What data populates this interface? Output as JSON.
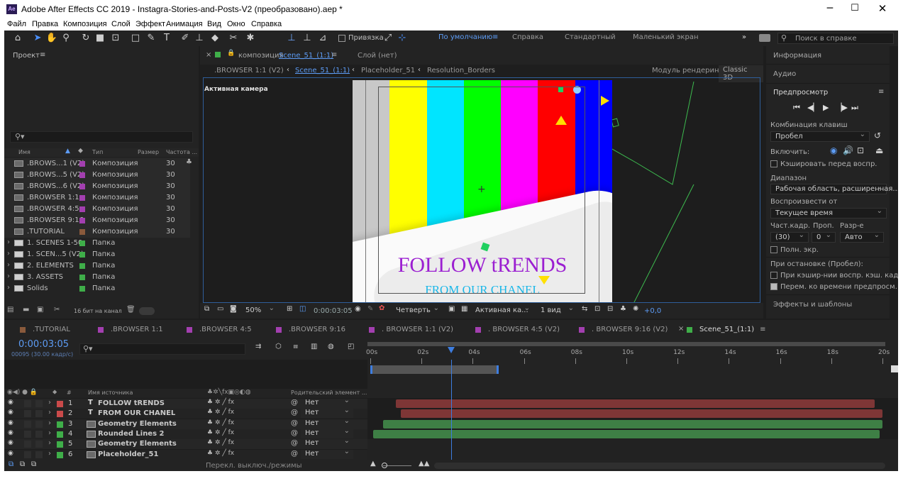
{
  "window": {
    "title": "Adobe After Effects CC 2019 - Instagra-Stories-and-Posts-V2 (преобразовано).aep *",
    "logo": "Ae"
  },
  "menu": [
    "Файл",
    "Правка",
    "Композиция",
    "Слой",
    "Эффект",
    "Анимация",
    "Вид",
    "Окно",
    "Справка"
  ],
  "toolbar": {
    "snap_label": "Привязка",
    "workspaces": [
      "По умолчанию",
      "Справка",
      "Стандартный",
      "Маленький экран"
    ],
    "search_placeholder": "Поиск в справке"
  },
  "project": {
    "title": "Проект",
    "columns": [
      "Имя",
      "Тип",
      "Размер",
      "Частота ..."
    ],
    "items": [
      {
        "name": ".BROWS...1 (V2)",
        "type": "Композиция",
        "fps": "30",
        "color": "#a33fb0",
        "kind": "comp"
      },
      {
        "name": ".BROWS...5 (V2)",
        "type": "Композиция",
        "fps": "30",
        "color": "#a33fb0",
        "kind": "comp"
      },
      {
        "name": ".BROWS...6 (V2)",
        "type": "Композиция",
        "fps": "30",
        "color": "#a33fb0",
        "kind": "comp"
      },
      {
        "name": ".BROWSER 1:1",
        "type": "Композиция",
        "fps": "30",
        "color": "#a33fb0",
        "kind": "comp"
      },
      {
        "name": ".BROWSER 4:5",
        "type": "Композиция",
        "fps": "30",
        "color": "#a33fb0",
        "kind": "comp"
      },
      {
        "name": ".BROWSER 9:16",
        "type": "Композиция",
        "fps": "30",
        "color": "#a33fb0",
        "kind": "comp"
      },
      {
        "name": ".TUTORIAL",
        "type": "Композиция",
        "fps": "30",
        "color": "#8a5a3c",
        "kind": "comp"
      },
      {
        "name": "1. SCENES 1-50",
        "type": "Папка",
        "fps": "",
        "color": "#3fae49",
        "kind": "folder"
      },
      {
        "name": "1. SCEN...5 (V2)",
        "type": "Папка",
        "fps": "",
        "color": "#3fae49",
        "kind": "folder"
      },
      {
        "name": "2. ELEMENTS",
        "type": "Папка",
        "fps": "",
        "color": "#3fae49",
        "kind": "folder"
      },
      {
        "name": "3. ASSETS",
        "type": "Папка",
        "fps": "",
        "color": "#3fae49",
        "kind": "folder"
      },
      {
        "name": "Solids",
        "type": "Папка",
        "fps": "",
        "color": "#3fae49",
        "kind": "folder"
      }
    ],
    "bit_depth": "16 бит на канал"
  },
  "composition": {
    "tab_prefix": "композиция",
    "tab_name": "Scene_51_(1:1)",
    "layer_tab": "Слой (нет)",
    "breadcrumbs": [
      ".BROWSER 1:1 (V2)",
      "Scene_51_(1:1)",
      "Placeholder_51",
      "Resolution_Borders"
    ],
    "renderer_label": "Модуль рендеринга:",
    "renderer_value": "Classic 3D",
    "camera_label": "Активная камера",
    "canvas_text_1": "FOLLOW tRENDS",
    "canvas_text_2": "FROM OUR CHANEL",
    "color_bars": [
      "#c8c8c8",
      "#ffff00",
      "#00e5ff",
      "#00ff00",
      "#ff00ff",
      "#ff0000",
      "#0000ff"
    ],
    "zoom": "50%",
    "timecode": "0:00:03:05",
    "resolution": "Четверть",
    "camera": "Активная ка...",
    "views": "1 вид",
    "exposure": "+0,0"
  },
  "right_panel": {
    "info": "Информация",
    "audio": "Аудио",
    "preview_title": "Предпросмотр",
    "shortcut_label": "Комбинация клавиш",
    "shortcut_value": "Пробел",
    "include_label": "Включить:",
    "cache_before": "Кэшировать перед воспр.",
    "range_label": "Диапазон",
    "range_value": "Рабочая область, расширенная...",
    "play_from_label": "Воспроизвести от",
    "play_from_value": "Текущее время",
    "frame_rate_label": "Част.кадр.",
    "skip_label": "Проп.",
    "resolution_label": "Разр-е",
    "frame_rate_value": "(30)",
    "skip_value": "0",
    "resolution_value": "Авто",
    "fullscreen": "Полн. экр.",
    "on_stop_label": "При остановке (Пробел):",
    "on_stop_1": "При кэшир-нии воспр. кэш. кадры",
    "on_stop_2": "Перем. ко времени предпросм.",
    "effects": "Эффекты и шаблоны"
  },
  "timeline": {
    "tabs": [
      {
        "label": ".TUTORIAL",
        "color": "#8a5a3c"
      },
      {
        "label": ".BROWSER 1:1",
        "color": "#a33fb0"
      },
      {
        "label": ".BROWSER 4:5",
        "color": "#a33fb0"
      },
      {
        "label": ".BROWSER 9:16",
        "color": "#a33fb0"
      },
      {
        "label": ". BROWSER 1:1 (V2)",
        "color": "#a33fb0"
      },
      {
        "label": ". BROWSER 4:5 (V2)",
        "color": "#a33fb0"
      },
      {
        "label": ". BROWSER 9:16 (V2)",
        "color": "#a33fb0"
      },
      {
        "label": "Scene_51_(1:1)",
        "color": "#3fae49"
      }
    ],
    "timecode": "0:00:03:05",
    "frames": "00095 (30.00 кадр/с)",
    "col_source": "Имя источника",
    "col_parent": "Родительский элемент ...",
    "ruler": [
      "00s",
      "02s",
      "04s",
      "06s",
      "08s",
      "10s",
      "12s",
      "14s",
      "16s",
      "18s",
      "20s"
    ],
    "playhead_seconds": 3.17,
    "work_area_end_seconds": 5.0,
    "duration_seconds": 20,
    "layers": [
      {
        "num": "1",
        "name": "FOLLOW tRENDS",
        "kind": "T",
        "color": "#c94a4a",
        "parent": "Нет",
        "start": 1.0,
        "end": 19.7
      },
      {
        "num": "2",
        "name": "FROM OUR CHANEL",
        "kind": "T",
        "color": "#c94a4a",
        "parent": "Нет",
        "start": 1.2,
        "end": 20.0
      },
      {
        "num": "3",
        "name": "Geometry Elements",
        "kind": "img",
        "color": "#3fae49",
        "parent": "Нет",
        "start": 0.5,
        "end": 20.0
      },
      {
        "num": "4",
        "name": "Rounded Lines 2",
        "kind": "img",
        "color": "#3fae49",
        "parent": "Нет",
        "start": 0.1,
        "end": 19.9
      },
      {
        "num": "5",
        "name": "Geometry Elements",
        "kind": "img",
        "color": "#3fae49",
        "parent": "Нет",
        "start": 0.0,
        "end": 19.8
      },
      {
        "num": "6",
        "name": "Placeholder_51",
        "kind": "img",
        "color": "#3fae49",
        "parent": "Нет",
        "start": 0.1,
        "end": 20.0
      }
    ],
    "footer": "Перекл. выключ./режимы"
  }
}
